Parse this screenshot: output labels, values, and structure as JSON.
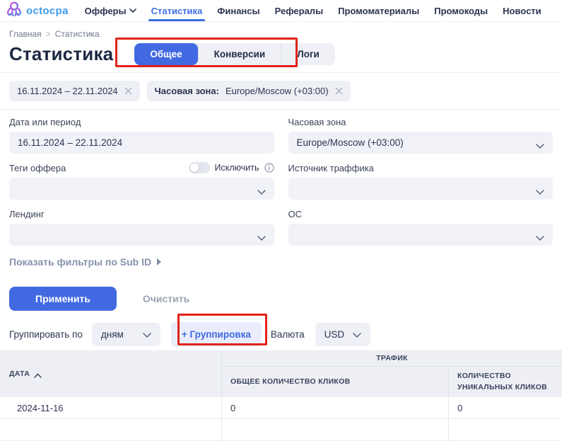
{
  "nav": {
    "logo_text": "octocpa",
    "items": [
      {
        "label": "Офферы"
      },
      {
        "label": "Статистика"
      },
      {
        "label": "Финансы"
      },
      {
        "label": "Рефералы"
      },
      {
        "label": "Промоматериалы"
      },
      {
        "label": "Промокоды"
      },
      {
        "label": "Новости"
      }
    ]
  },
  "breadcrumb": {
    "home": "Главная",
    "separator": ">",
    "current": "Статистика"
  },
  "page_title": "Статистика",
  "tabs": {
    "general": "Общее",
    "conversions": "Конверсии",
    "logs": "Логи"
  },
  "chips": {
    "date_range": "16.11.2024 – 22.11.2024",
    "timezone_label": "Часовая зона:",
    "timezone_value": "Europe/Moscow (+03:00)"
  },
  "filters": {
    "date_label": "Дата или период",
    "date_value": "16.11.2024 – 22.11.2024",
    "timezone_label": "Часовая зона",
    "timezone_value": "Europe/Moscow (+03:00)",
    "offer_tags_label": "Теги оффера",
    "exclude_label": "Исключить",
    "traffic_source_label": "Источник траффика",
    "landing_label": "Лендинг",
    "os_label": "ОС",
    "subid_link": "Показать фильтры по Sub ID",
    "apply_label": "Применить",
    "clear_label": "Очистить"
  },
  "grouping": {
    "group_by_label": "Группировать по",
    "group_by_value": "дням",
    "add_group_label": "+ Группировка",
    "currency_label": "Валюта",
    "currency_value": "USD"
  },
  "table": {
    "date_header": "ДАТА",
    "group_header": "ТРАФИК",
    "total_clicks_header": "ОБЩЕЕ КОЛИЧЕСТВО КЛИКОВ",
    "unique_clicks_header": "КОЛИЧЕСТВО УНИКАЛЬНЫХ КЛИКОВ",
    "rows": [
      {
        "date": "2024-11-16",
        "total_clicks": "0",
        "unique_clicks": "0"
      }
    ]
  },
  "colors": {
    "accent_blue": "#4169e1",
    "annotation_red": "#e2231a",
    "field_bg": "#f1f2f8",
    "table_header_bg": "#edeff4",
    "logo_gradient": [
      "#e85bc8",
      "#8e5cf0",
      "#3e9bed"
    ]
  }
}
